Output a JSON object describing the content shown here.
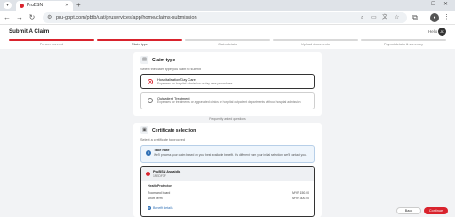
{
  "browser": {
    "tab_title": "PruBSN",
    "url": "pru-gbpt.com/pbtb/uat/pruservices/app/home/claims-submission",
    "colors": {
      "brand": "#d9232d",
      "tab_strip": "#dfe3e8"
    }
  },
  "header": {
    "title": "Submit A Claim",
    "user_name": "Hello",
    "user_initials": "JK"
  },
  "stepper": {
    "steps": [
      {
        "label": "Person covered",
        "state": "done"
      },
      {
        "label": "Claim type",
        "state": "active"
      },
      {
        "label": "Claim details",
        "state": "pending"
      },
      {
        "label": "Upload documents",
        "state": "pending"
      },
      {
        "label": "Payout details & summary",
        "state": "pending"
      }
    ]
  },
  "claim_type": {
    "title": "Claim type",
    "subtitle": "Select the claim type you want to submit",
    "options": [
      {
        "title": "Hospitalisation/Day Care",
        "description": "Expenses for hospital admission or day care procedures",
        "selected": true
      },
      {
        "title": "Outpatient Treatment",
        "description": "Expenses for treatments or aggravated clinics or hospital outpatient departments without hospital admission",
        "selected": false
      }
    ]
  },
  "faq_link": "Frequently asked questions",
  "certificate": {
    "title": "Certificate selection",
    "subtitle": "Select a certificate to proceed",
    "note_title": "Take note",
    "note_text": "We'll process your claim based on your best available benefit. It's different from your initial selection, we'll contact you.",
    "selected_name": "PruBSN Asnaidia",
    "selected_id": "1PEDF3F",
    "plan_name": "HealthProtector",
    "benefits": [
      {
        "label": "Room and board",
        "amount": "MYR 150.00"
      },
      {
        "label": "Short Term",
        "amount": "MYR 300.00"
      }
    ],
    "more_link": "Benefit details"
  },
  "footer": {
    "back_label": "Back",
    "continue_label": "Continue"
  }
}
